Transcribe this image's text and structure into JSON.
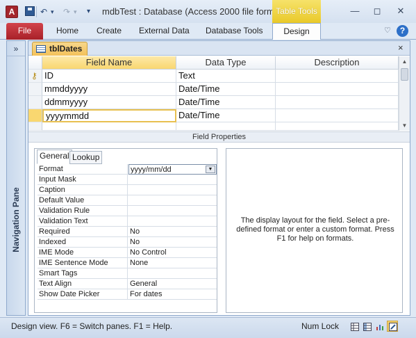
{
  "window": {
    "app_icon": "A",
    "title": "mdbTest : Database (Access 2000 file form...",
    "context_tab": "Table Tools",
    "controls": {
      "minimize": "—",
      "restore": "◻",
      "close": "✕"
    }
  },
  "quick_access": {
    "undo": "↶",
    "redo": "↷",
    "dropdown": "▾",
    "customize": "▾"
  },
  "ribbon": {
    "file_label": "File",
    "tabs": [
      "Home",
      "Create",
      "External Data",
      "Database Tools"
    ],
    "active_tab": "Design",
    "minimize_glyph": "♡",
    "help_glyph": "?"
  },
  "nav_pane": {
    "label": "Navigation Pane",
    "toggle": "»"
  },
  "document": {
    "tab_label": "tblDates",
    "close_glyph": "×",
    "columns": [
      "Field Name",
      "Data Type",
      "Description"
    ],
    "rows": [
      {
        "name": "ID",
        "type": "Text",
        "description": ""
      },
      {
        "name": "mmddyyyy",
        "type": "Date/Time",
        "description": ""
      },
      {
        "name": "ddmmyyyy",
        "type": "Date/Time",
        "description": ""
      },
      {
        "name": "yyyymmdd",
        "type": "Date/Time",
        "description": ""
      }
    ],
    "field_properties_label": "Field Properties"
  },
  "properties": {
    "tabs": [
      "General",
      "Lookup"
    ],
    "rows": [
      {
        "name": "Format",
        "value": "yyyy/mm/dd"
      },
      {
        "name": "Input Mask",
        "value": ""
      },
      {
        "name": "Caption",
        "value": ""
      },
      {
        "name": "Default Value",
        "value": ""
      },
      {
        "name": "Validation Rule",
        "value": ""
      },
      {
        "name": "Validation Text",
        "value": ""
      },
      {
        "name": "Required",
        "value": "No"
      },
      {
        "name": "Indexed",
        "value": "No"
      },
      {
        "name": "IME Mode",
        "value": "No Control"
      },
      {
        "name": "IME Sentence Mode",
        "value": "None"
      },
      {
        "name": "Smart Tags",
        "value": ""
      },
      {
        "name": "Text Align",
        "value": "General"
      },
      {
        "name": "Show Date Picker",
        "value": "For dates"
      }
    ],
    "help_text": "The display layout for the field. Select a pre-defined format or enter a custom format. Press F1 for help on formats."
  },
  "status": {
    "text": "Design view.  F6 = Switch panes.  F1 = Help.",
    "num_lock": "Num Lock"
  },
  "colors": {
    "file_tab": "#b82d35",
    "context_tab": "#f0d040",
    "accent": "#2f5a94"
  }
}
